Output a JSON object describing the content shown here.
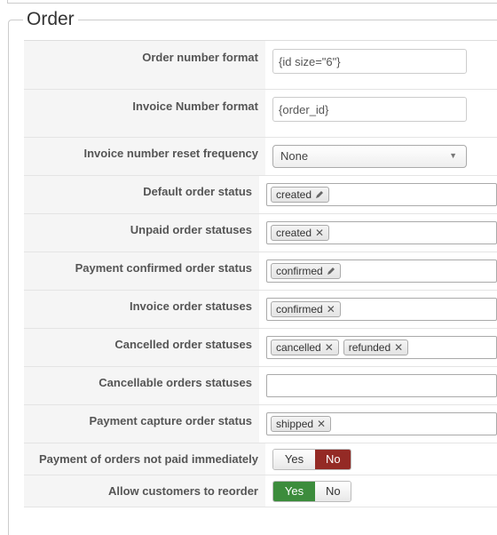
{
  "section": {
    "title": "Order"
  },
  "fields": {
    "order_number_format": {
      "label": "Order number format",
      "value": "{id size=\"6\"}"
    },
    "invoice_number_format": {
      "label": "Invoice Number format",
      "value": "{order_id}"
    },
    "invoice_reset": {
      "label": "Invoice number reset frequency",
      "selected": "None"
    },
    "default_status": {
      "label": "Default order status",
      "tags": [
        "created"
      ]
    },
    "unpaid_statuses": {
      "label": "Unpaid order statuses",
      "tags": [
        "created"
      ]
    },
    "payment_confirmed": {
      "label": "Payment confirmed order status",
      "tags": [
        "confirmed"
      ]
    },
    "invoice_statuses": {
      "label": "Invoice order statuses",
      "tags": [
        "confirmed"
      ]
    },
    "cancelled_statuses": {
      "label": "Cancelled order statuses",
      "tags": [
        "cancelled",
        "refunded"
      ]
    },
    "cancellable_statuses": {
      "label": "Cancellable orders statuses",
      "tags": []
    },
    "capture_status": {
      "label": "Payment capture order status",
      "tags": [
        "shipped"
      ]
    },
    "not_paid_immediately": {
      "label": "Payment of orders not paid immediately",
      "yes": "Yes",
      "no": "No",
      "value": "No"
    },
    "allow_reorder": {
      "label": "Allow customers to reorder",
      "yes": "Yes",
      "no": "No",
      "value": "Yes"
    }
  },
  "colors": {
    "toggle_no_active": "#942a25",
    "toggle_yes_active": "#3c8c3c"
  },
  "icons": {
    "edit": "pencil-icon",
    "remove": "x-icon",
    "dropdown": "caret-down-icon"
  }
}
